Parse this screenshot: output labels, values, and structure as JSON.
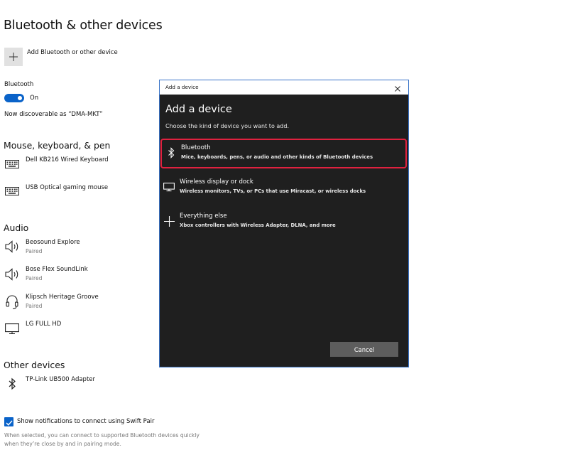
{
  "page": {
    "title": "Bluetooth & other devices",
    "add_device_label": "Add Bluetooth or other device",
    "bluetooth_label": "Bluetooth",
    "toggle_state": "On",
    "discoverable_text": "Now discoverable as “DMA-MKT”"
  },
  "sections": {
    "mouse_keyboard": {
      "title": "Mouse, keyboard, & pen",
      "devices": [
        {
          "name": "Dell KB216 Wired Keyboard",
          "icon": "keyboard-icon"
        },
        {
          "name": "USB Optical gaming mouse",
          "icon": "keyboard-icon"
        }
      ]
    },
    "audio": {
      "title": "Audio",
      "devices": [
        {
          "name": "Beosound Explore",
          "status": "Paired",
          "icon": "speaker-icon"
        },
        {
          "name": "Bose Flex SoundLink",
          "status": "Paired",
          "icon": "speaker-icon"
        },
        {
          "name": "Klipsch Heritage Groove",
          "status": "Paired",
          "icon": "headset-icon"
        },
        {
          "name": "LG FULL HD",
          "icon": "monitor-icon"
        }
      ]
    },
    "other": {
      "title": "Other devices",
      "devices": [
        {
          "name": "TP-Link UB500 Adapter",
          "icon": "bluetooth-icon"
        }
      ]
    }
  },
  "swift_pair": {
    "checkbox_label": "Show notifications to connect using Swift Pair",
    "description_line1": "When selected, you can connect to supported Bluetooth devices quickly",
    "description_line2": "when they’re close by and in pairing mode.",
    "checked": true
  },
  "dialog": {
    "window_title": "Add a device",
    "heading": "Add a device",
    "subtitle": "Choose the kind of device you want to add.",
    "options": [
      {
        "title": "Bluetooth",
        "description": "Mice, keyboards, pens, or audio and other kinds of Bluetooth devices",
        "icon": "bluetooth-icon",
        "selected": true
      },
      {
        "title": "Wireless display or dock",
        "description": "Wireless monitors, TVs, or PCs that use Miracast, or wireless docks",
        "icon": "monitor-icon"
      },
      {
        "title": "Everything else",
        "description": "Xbox controllers with Wireless Adapter, DLNA, and more",
        "icon": "plus-icon"
      }
    ],
    "cancel_label": "Cancel"
  },
  "colors": {
    "accent": "#0a63c9",
    "dialog_bg": "#1f1f1f",
    "selection_border": "#e0213f",
    "cancel_bg": "#5d5d5d"
  }
}
